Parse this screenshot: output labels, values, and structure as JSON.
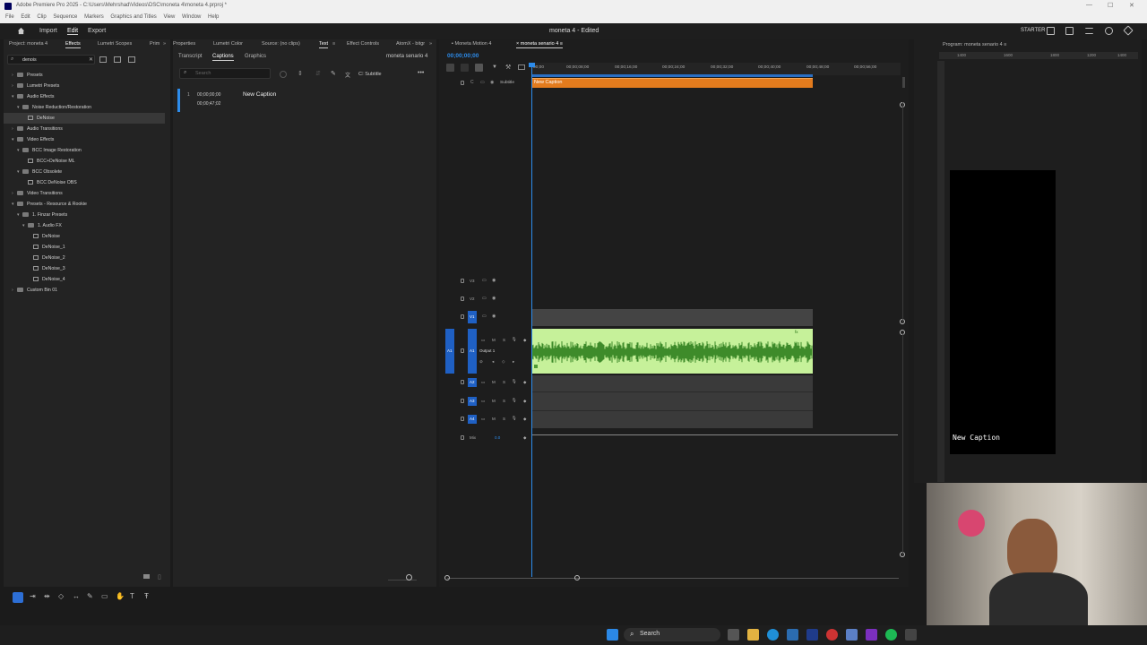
{
  "window": {
    "title": "Adobe Premiere Pro 2025 - C:\\Users\\Mehrshad\\Videos\\DSC\\moneta 4\\moneta 4.prproj *"
  },
  "menu": [
    "File",
    "Edit",
    "Clip",
    "Sequence",
    "Markers",
    "Graphics and Titles",
    "View",
    "Window",
    "Help"
  ],
  "header": {
    "nav": [
      "Import",
      "Edit",
      "Export"
    ],
    "active_nav": "Edit",
    "project_title": "moneta 4 - Edited",
    "badge": "STARTER"
  },
  "left_panel": {
    "tabs": [
      "Project: moneta 4",
      "Effects",
      "Lumetri Scopes",
      "Prim"
    ],
    "active_tab": "Effects",
    "search_value": "denois",
    "tree": [
      {
        "label": "Presets",
        "level": 0,
        "type": "folder",
        "expanded": false
      },
      {
        "label": "Lumetri Presets",
        "level": 0,
        "type": "folder",
        "expanded": false
      },
      {
        "label": "Audio Effects",
        "level": 0,
        "type": "folder",
        "expanded": true
      },
      {
        "label": "Noise Reduction/Restoration",
        "level": 1,
        "type": "folder",
        "expanded": true
      },
      {
        "label": "DeNoise",
        "level": 2,
        "type": "effect",
        "selected": true
      },
      {
        "label": "Audio Transitions",
        "level": 0,
        "type": "folder",
        "expanded": false
      },
      {
        "label": "Video Effects",
        "level": 0,
        "type": "folder",
        "expanded": true
      },
      {
        "label": "BCC Image Restoration",
        "level": 1,
        "type": "folder",
        "expanded": true
      },
      {
        "label": "BCC+DeNoise ML",
        "level": 2,
        "type": "effect"
      },
      {
        "label": "BCC Obsolete",
        "level": 1,
        "type": "folder",
        "expanded": true
      },
      {
        "label": "BCC DeNoise OBS",
        "level": 2,
        "type": "effect"
      },
      {
        "label": "Video Transitions",
        "level": 0,
        "type": "folder",
        "expanded": false
      },
      {
        "label": "Presets - Resource & Rookie",
        "level": 0,
        "type": "folder",
        "expanded": true
      },
      {
        "label": "1. Finzar Presets",
        "level": 1,
        "type": "folder",
        "expanded": true
      },
      {
        "label": "1. Audio FX",
        "level": 2,
        "type": "folder",
        "expanded": true
      },
      {
        "label": "DeNoise",
        "level": 3,
        "type": "effect"
      },
      {
        "label": "DeNoise_1",
        "level": 3,
        "type": "effect"
      },
      {
        "label": "DeNoise_2",
        "level": 3,
        "type": "effect"
      },
      {
        "label": "DeNoise_3",
        "level": 3,
        "type": "effect"
      },
      {
        "label": "DeNoise_4",
        "level": 3,
        "type": "effect"
      },
      {
        "label": "Custom Bin 01",
        "level": 0,
        "type": "folder",
        "expanded": false
      }
    ]
  },
  "text_panel": {
    "tabs": [
      "Properties",
      "Lumetri Color",
      "Source: (no clips)",
      "Text",
      "Effect Controls",
      "AtomX - bitgr"
    ],
    "active_tab": "Text",
    "subtabs": [
      "Transcript",
      "Captions",
      "Graphics"
    ],
    "active_subtab": "Captions",
    "sequence": "moneta senario 4",
    "search_placeholder": "Search",
    "subtitle_label": "Subtitle",
    "captions": [
      {
        "index": "1",
        "in": "00;00;00;00",
        "out": "00;00;47;02",
        "text": "New Caption"
      }
    ]
  },
  "timeline": {
    "tabs": [
      "Moneta Motion 4",
      "moneta senario 4"
    ],
    "active_tab": "moneta senario 4",
    "timecode": "00;00;00;00",
    "ruler": [
      "00;00",
      "00;00;08;00",
      "00;00;16;00",
      "00;00;24;00",
      "00;00;32;00",
      "00;00;40;00",
      "00;00;48;00",
      "00;00;56;00"
    ],
    "caption_track_label": "Subtitle",
    "caption_clip": "New Caption",
    "video_tracks": [
      "V3",
      "V2",
      "V1"
    ],
    "audio_tracks": [
      "A1",
      "A2",
      "A3",
      "A4"
    ],
    "source_patch_v": "V1",
    "source_patch_a": "A1",
    "audio_output": "Output 1",
    "mix_label": "Mix",
    "mix_value": "0.0"
  },
  "program_monitor": {
    "tab": "Program: moneta senario 4",
    "ruler": [
      "1400",
      "1600",
      "1800",
      "1200",
      "1400"
    ],
    "caption_text": "New Caption"
  },
  "taskbar": {
    "search_label": "Search"
  },
  "colors": {
    "accent_blue": "#2d8ceb",
    "caption_bar": "#e37b1d",
    "audio_clip": "#c6f19a",
    "waveform": "#3e8b2a",
    "track_patch": "#1f60c4"
  }
}
